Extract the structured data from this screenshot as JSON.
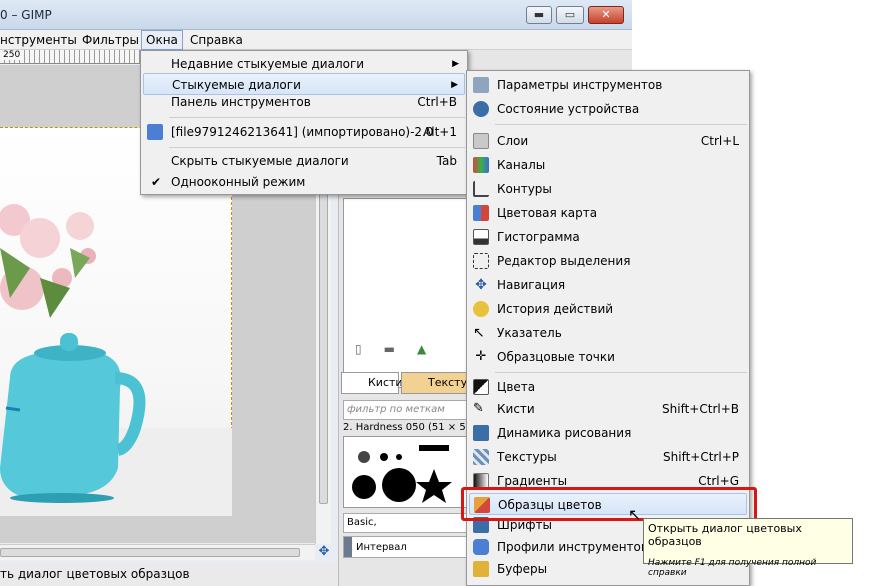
{
  "window": {
    "title": "0 – GIMP",
    "buttons": {
      "minimize": "▬",
      "maximize": "▭",
      "close": "✕"
    }
  },
  "menubar": {
    "items": [
      "нструменты",
      "Фильтры",
      "Окна",
      "Справка"
    ]
  },
  "ruler": {
    "first_label": "250"
  },
  "windows_menu": {
    "items": [
      {
        "label": "Недавние стыкуемые диалоги",
        "submenu": true
      },
      {
        "label": "Стыкуемые диалоги",
        "submenu": true
      },
      {
        "label": "Панель инструментов",
        "shortcut": "Ctrl+B"
      },
      {
        "label": "[file9791246213641] (импортировано)-2.0",
        "shortcut": "Alt+1"
      },
      {
        "label": "Скрыть стыкуемые диалоги",
        "shortcut": "Tab"
      },
      {
        "label": "Однооконный режим",
        "checked": true
      }
    ],
    "check_mark": "✔",
    "arrow": "▶"
  },
  "dockable_menu": {
    "items": [
      {
        "label": "Параметры инструментов",
        "shortcut": "",
        "icon": "tool-options-icon",
        "color": "#8fa4bf"
      },
      {
        "label": "Состояние устройства",
        "shortcut": "",
        "icon": "device-status-icon",
        "color": "#3b6ea8"
      },
      {
        "label": "Слои",
        "shortcut": "Ctrl+L",
        "icon": "layers-icon",
        "color": "#c9c9c9"
      },
      {
        "label": "Каналы",
        "shortcut": "",
        "icon": "channels-icon",
        "color": "#d2473b"
      },
      {
        "label": "Контуры",
        "shortcut": "",
        "icon": "paths-icon",
        "color": "#444444"
      },
      {
        "label": "Цветовая карта",
        "shortcut": "",
        "icon": "colormap-icon",
        "color": "#4a7fd4"
      },
      {
        "label": "Гистограмма",
        "shortcut": "",
        "icon": "histogram-icon",
        "color": "#333333"
      },
      {
        "label": "Редактор выделения",
        "shortcut": "",
        "icon": "selection-editor-icon",
        "color": "#ffffff"
      },
      {
        "label": "Навигация",
        "shortcut": "",
        "icon": "navigation-icon",
        "color": "#2a5aa0"
      },
      {
        "label": "История действий",
        "shortcut": "",
        "icon": "undo-history-icon",
        "color": "#e8c23a"
      },
      {
        "label": "Указатель",
        "shortcut": "",
        "icon": "pointer-icon",
        "color": "#ffffff"
      },
      {
        "label": "Образцовые точки",
        "shortcut": "",
        "icon": "sample-points-icon",
        "color": "#333333"
      },
      {
        "label": "Цвета",
        "shortcut": "",
        "icon": "colors-icon",
        "color": "#111111"
      },
      {
        "label": "Кисти",
        "shortcut": "Shift+Ctrl+B",
        "icon": "brushes-icon",
        "color": "#5a5a5a"
      },
      {
        "label": "Динамика рисования",
        "shortcut": "",
        "icon": "paint-dynamics-icon",
        "color": "#3b6ea8"
      },
      {
        "label": "Текстуры",
        "shortcut": "Shift+Ctrl+P",
        "icon": "patterns-icon",
        "color": "#6a8fb8"
      },
      {
        "label": "Градиенты",
        "shortcut": "Ctrl+G",
        "icon": "gradients-icon",
        "color": "#777777"
      },
      {
        "label": "Образцы цветов",
        "shortcut": "",
        "icon": "palettes-icon",
        "color": "#e8a13a"
      },
      {
        "label": "Шрифты",
        "shortcut": "",
        "icon": "fonts-icon",
        "color": "#3b6ea8"
      },
      {
        "label": "Профили инструментов",
        "shortcut": "",
        "icon": "tool-presets-icon",
        "color": "#4a7fd4"
      },
      {
        "label": "Буферы",
        "shortcut": "",
        "icon": "buffers-icon",
        "color": "#e0b23a"
      }
    ]
  },
  "tooltip": {
    "text": "Открыть диалог цветовых образцов",
    "hint": "Нажмите F1 для получения полной справки"
  },
  "dock": {
    "brush_tab": "Кисти",
    "pattern_tab": "Текстуры",
    "filter_placeholder": "фильтр по меткам",
    "brush_name": "2. Hardness 050 (51 × 51)",
    "preset": "Basic,",
    "spacing_label": "Интервал"
  },
  "statusbar": {
    "text": "ть диалог цветовых образцов"
  },
  "colors": {
    "highlight": "#d91515",
    "selected_item": "#d6e5f8"
  }
}
